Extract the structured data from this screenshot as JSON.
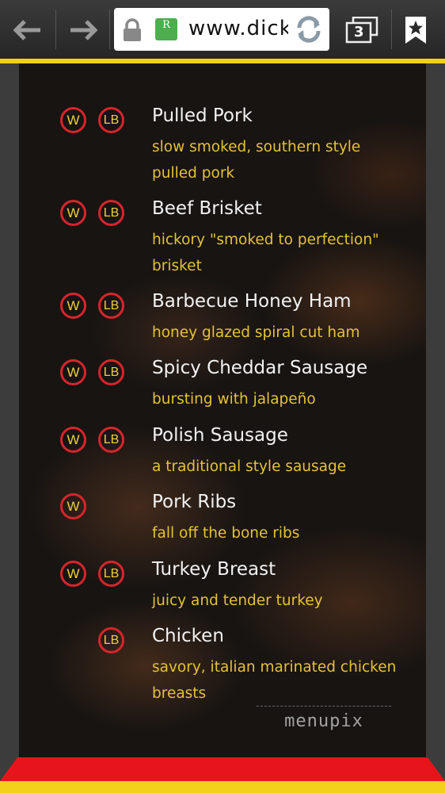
{
  "browser": {
    "url": "www.dicke",
    "tab_count": "3",
    "favicon_letter": "R"
  },
  "colors": {
    "accent_yellow": "#f2d11a",
    "badge_ring": "#d8242b",
    "description_text": "#e4c237",
    "footer_red": "#e8141c"
  },
  "menu": {
    "items": [
      {
        "name": "Pulled Pork",
        "description": "slow smoked, southern style pulled pork",
        "w": "W",
        "lb": "LB"
      },
      {
        "name": "Beef Brisket",
        "description": "hickory \"smoked to perfection\" brisket",
        "w": "W",
        "lb": "LB"
      },
      {
        "name": "Barbecue Honey Ham",
        "description": "honey glazed spiral cut ham",
        "w": "W",
        "lb": "LB"
      },
      {
        "name": "Spicy Cheddar Sausage",
        "description": "bursting with jalapeño",
        "w": "W",
        "lb": "LB"
      },
      {
        "name": "Polish Sausage",
        "description": "a traditional style sausage",
        "w": "W",
        "lb": "LB"
      },
      {
        "name": "Pork Ribs",
        "description": "fall off the bone ribs",
        "w": "W"
      },
      {
        "name": "Turkey Breast",
        "description": "juicy and tender turkey",
        "w": "W",
        "lb": "LB"
      },
      {
        "name": "Chicken",
        "description": "savory, italian marinated chicken breasts",
        "lb": "LB"
      }
    ]
  },
  "watermark": "menupix"
}
